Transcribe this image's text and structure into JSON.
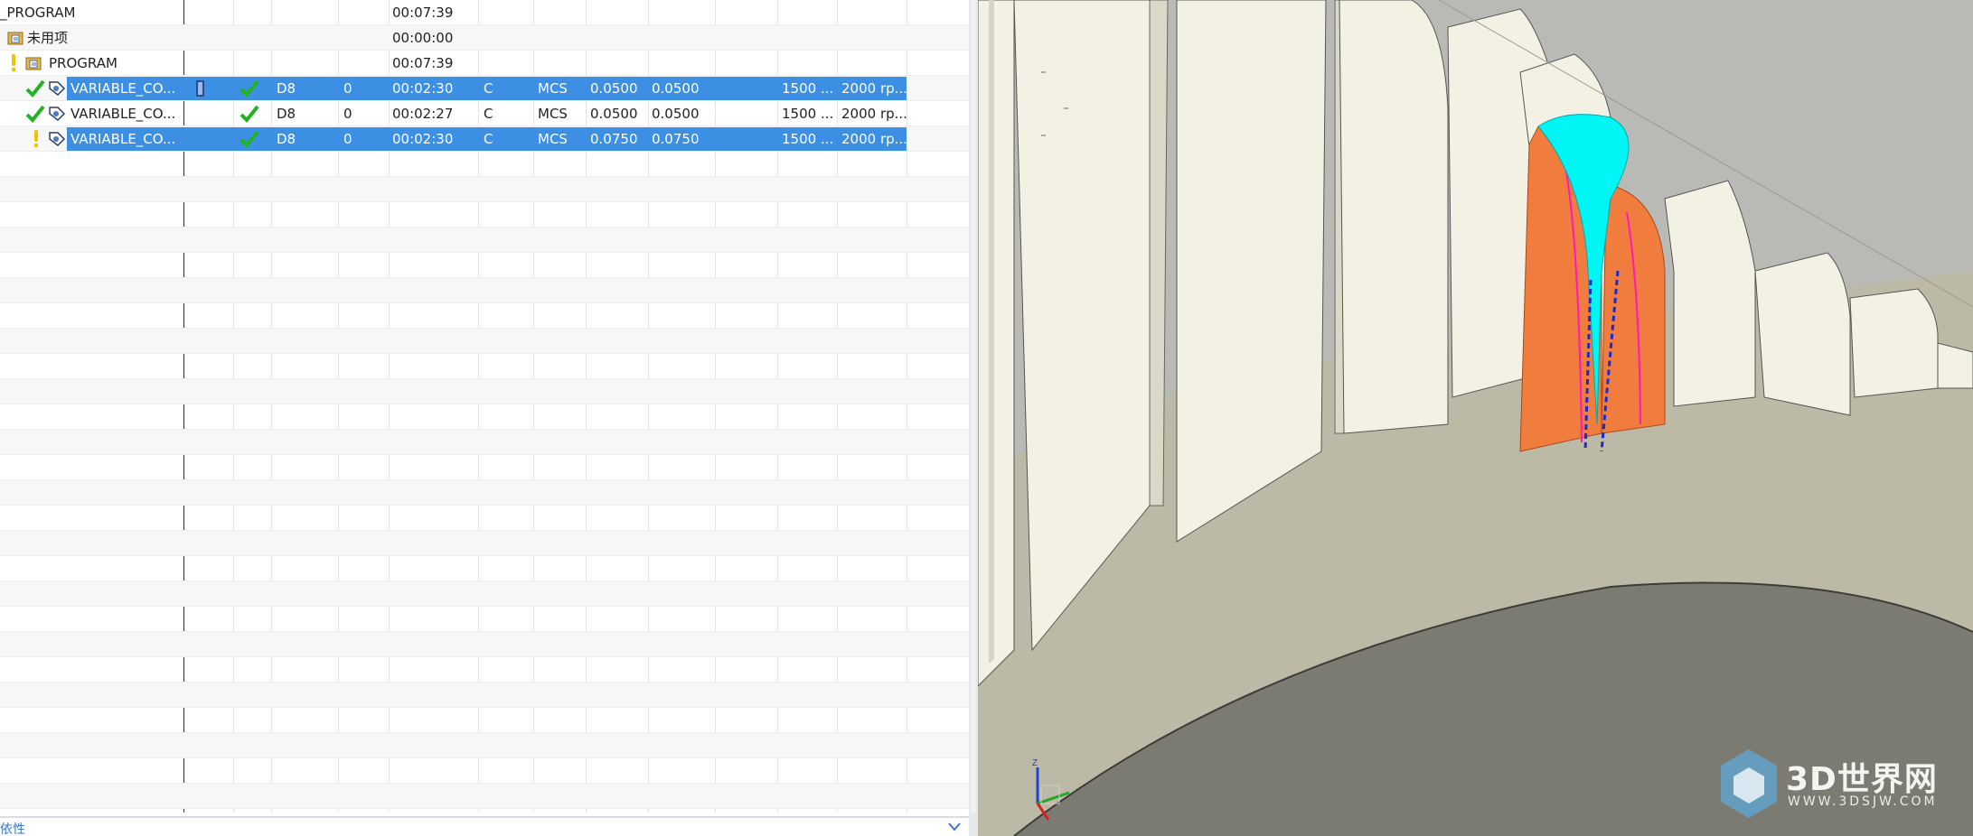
{
  "navigator": {
    "rows": [
      {
        "name": "_PROGRAM",
        "time": "00:07:39"
      },
      {
        "name": "未用项",
        "time": "00:00:00"
      },
      {
        "name": "PROGRAM",
        "time": "00:07:39"
      },
      {
        "name": "VARIABLE_CO...",
        "tool": "D8",
        "num": "0",
        "time": "00:02:30",
        "geom": "C",
        "mcs": "MCS",
        "stock1": "0.0500",
        "stock2": "0.0500",
        "feed": "1500 ...",
        "speed": "2000 rp..."
      },
      {
        "name": "VARIABLE_CO...",
        "tool": "D8",
        "num": "0",
        "time": "00:02:27",
        "geom": "C",
        "mcs": "MCS",
        "stock1": "0.0500",
        "stock2": "0.0500",
        "feed": "1500 ...",
        "speed": "2000 rp..."
      },
      {
        "name": "VARIABLE_CO...",
        "tool": "D8",
        "num": "0",
        "time": "00:02:30",
        "geom": "C",
        "mcs": "MCS",
        "stock1": "0.0750",
        "stock2": "0.0750",
        "feed": "1500 ...",
        "speed": "2000 rp..."
      }
    ],
    "bottom_label": "依性"
  },
  "colors": {
    "selection": "#3d8fe3",
    "check": "#22b322",
    "warning": "#f2c200",
    "part_face": "#f3f1e4",
    "part_body": "#bbb8a4",
    "blade_orange": "#f07c3e",
    "tool_cyan": "#00f5f5",
    "path_blue": "#1a2ad0"
  },
  "icons": [
    "check-icon",
    "warning-icon",
    "operation-icon",
    "program-group-icon",
    "machine-icon",
    "collapse-chevron-icon",
    "axis-triad-icon"
  ],
  "watermark": {
    "brand": "3D世界网",
    "url": "WWW.3DSJW.COM"
  }
}
